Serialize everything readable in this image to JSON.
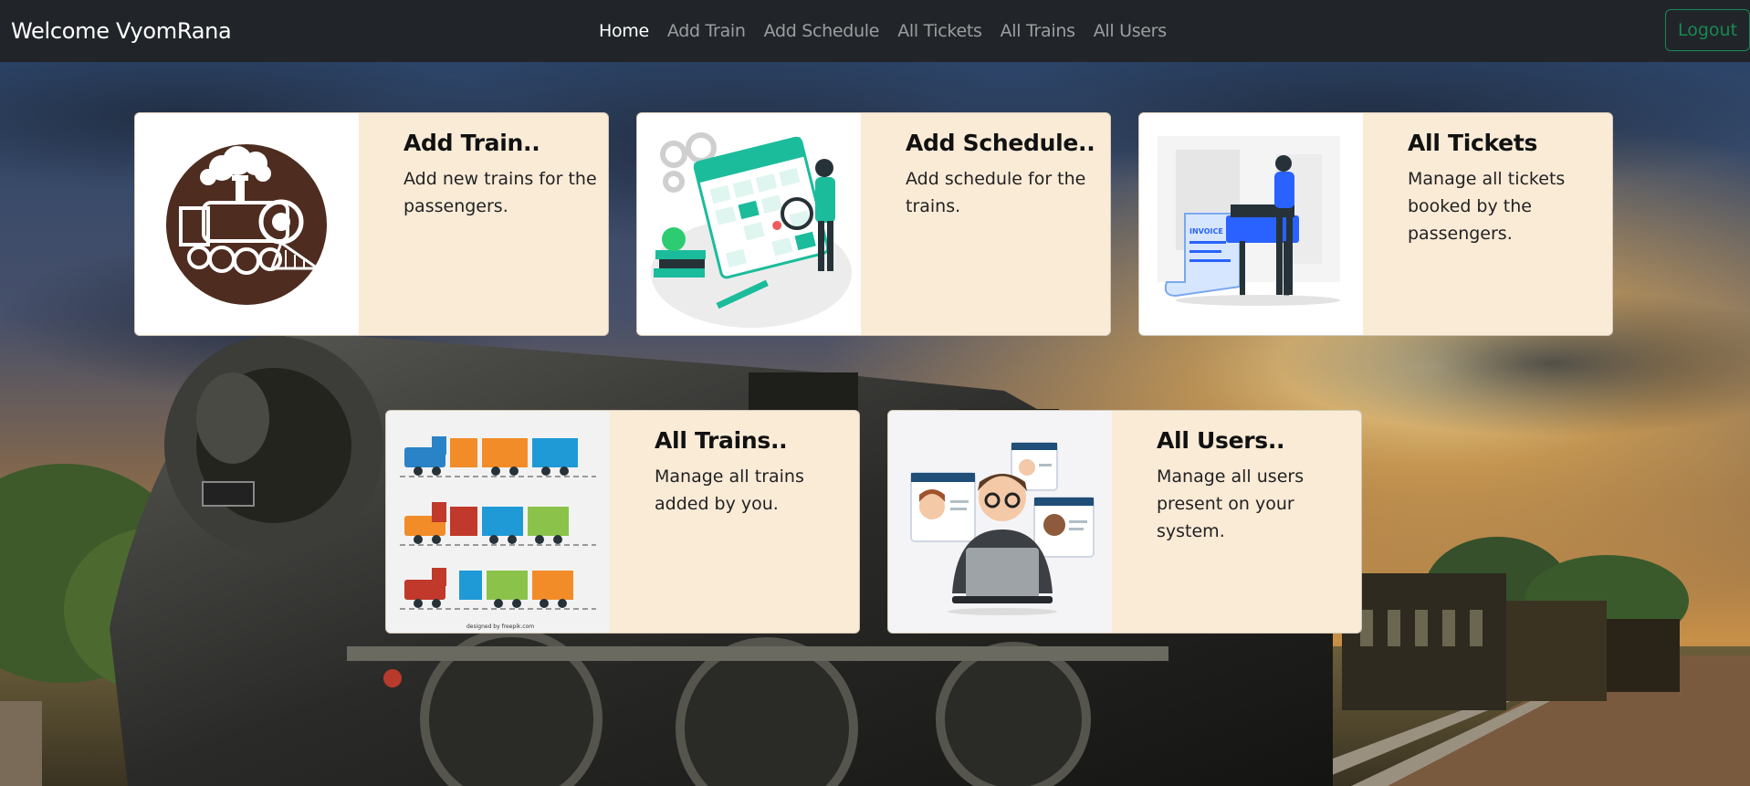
{
  "nav": {
    "brand": "Welcome VyomRana",
    "links": [
      {
        "label": "Home",
        "active": true
      },
      {
        "label": "Add Train",
        "active": false
      },
      {
        "label": "Add Schedule",
        "active": false
      },
      {
        "label": "All Tickets",
        "active": false
      },
      {
        "label": "All Trains",
        "active": false
      },
      {
        "label": "All Users",
        "active": false
      }
    ],
    "logout_label": "Logout"
  },
  "cards": [
    {
      "title": "Add Train..",
      "text": "Add new trains for the passengers.",
      "image": "steam-locomotive-illustration"
    },
    {
      "title": "Add Schedule..",
      "text": "Add schedule for the trains.",
      "image": "calendar-schedule-illustration"
    },
    {
      "title": "All Tickets",
      "text": "Manage all tickets booked by the passengers.",
      "image": "invoice-printer-illustration"
    },
    {
      "title": "All Trains..",
      "text": "Manage all trains added by you.",
      "image": "toy-trains-illustration"
    },
    {
      "title": "All Users..",
      "text": "Manage all users present on your system.",
      "image": "user-profiles-illustration"
    }
  ],
  "illustrations": {
    "invoice_label": "INVOICE",
    "credit": "designed by freepik.com"
  },
  "colors": {
    "navbar_bg": "#212529",
    "card_bg": "#faebd7",
    "logout": "#198754"
  }
}
